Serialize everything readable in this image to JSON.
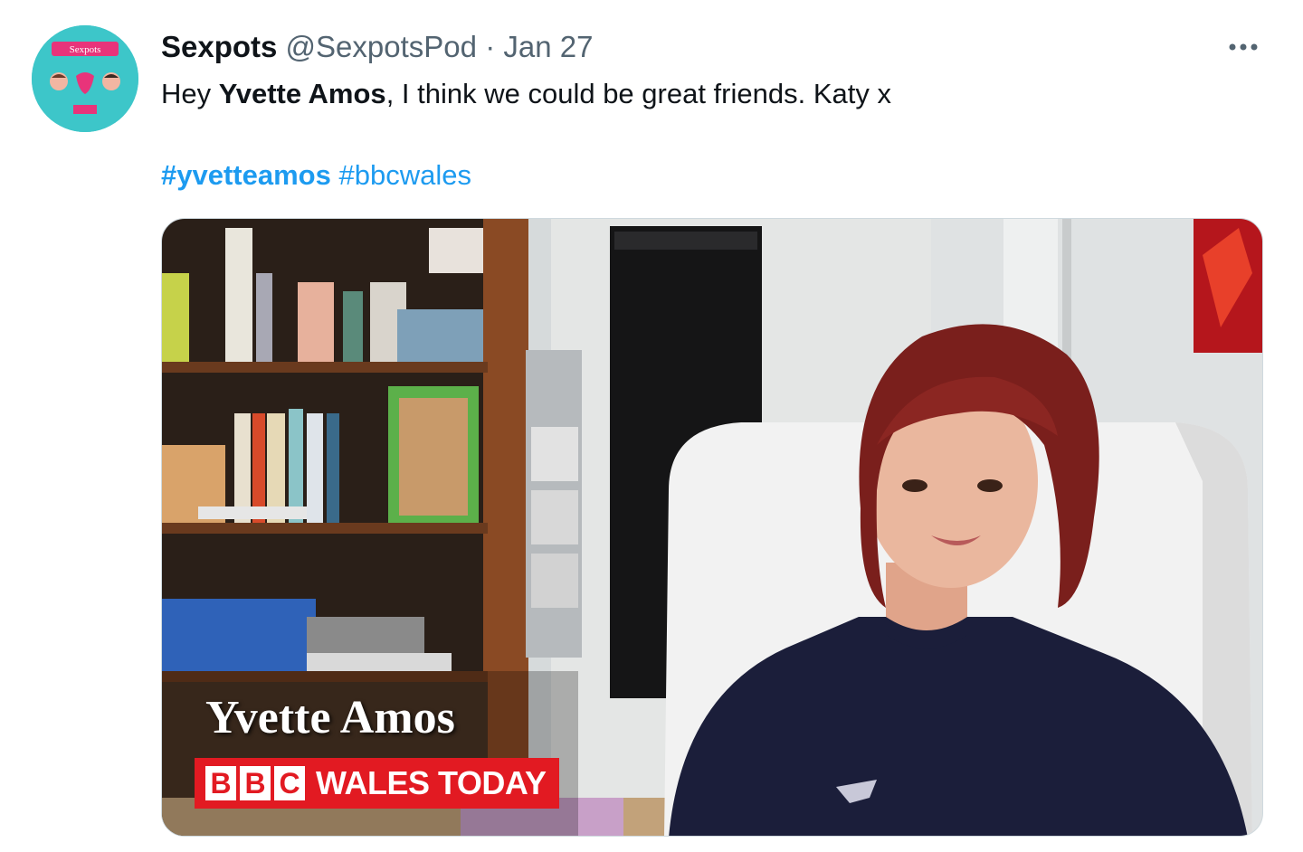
{
  "tweet": {
    "avatar": {
      "icon": "sexpots-logo-icon",
      "text": "Sexpots"
    },
    "display_name": "Sexpots",
    "handle": "@SexpotsPod",
    "separator": "·",
    "date": "Jan 27",
    "more_icon": "more-options-icon",
    "text_before": "Hey ",
    "text_bold": "Yvette Amos",
    "text_after": ", I think we could be great friends. Katy x",
    "hashtags": [
      "#yvetteamos",
      "#bbcwales"
    ]
  },
  "media": {
    "caption_name": "Yvette Amos",
    "bbc_letters": [
      "B",
      "B",
      "C"
    ],
    "programme": "WALES TODAY"
  },
  "colors": {
    "link": "#1d9bf0",
    "secondary_text": "#536471",
    "bbc_red": "#e21a22",
    "avatar_bg": "#3dc6c9"
  }
}
